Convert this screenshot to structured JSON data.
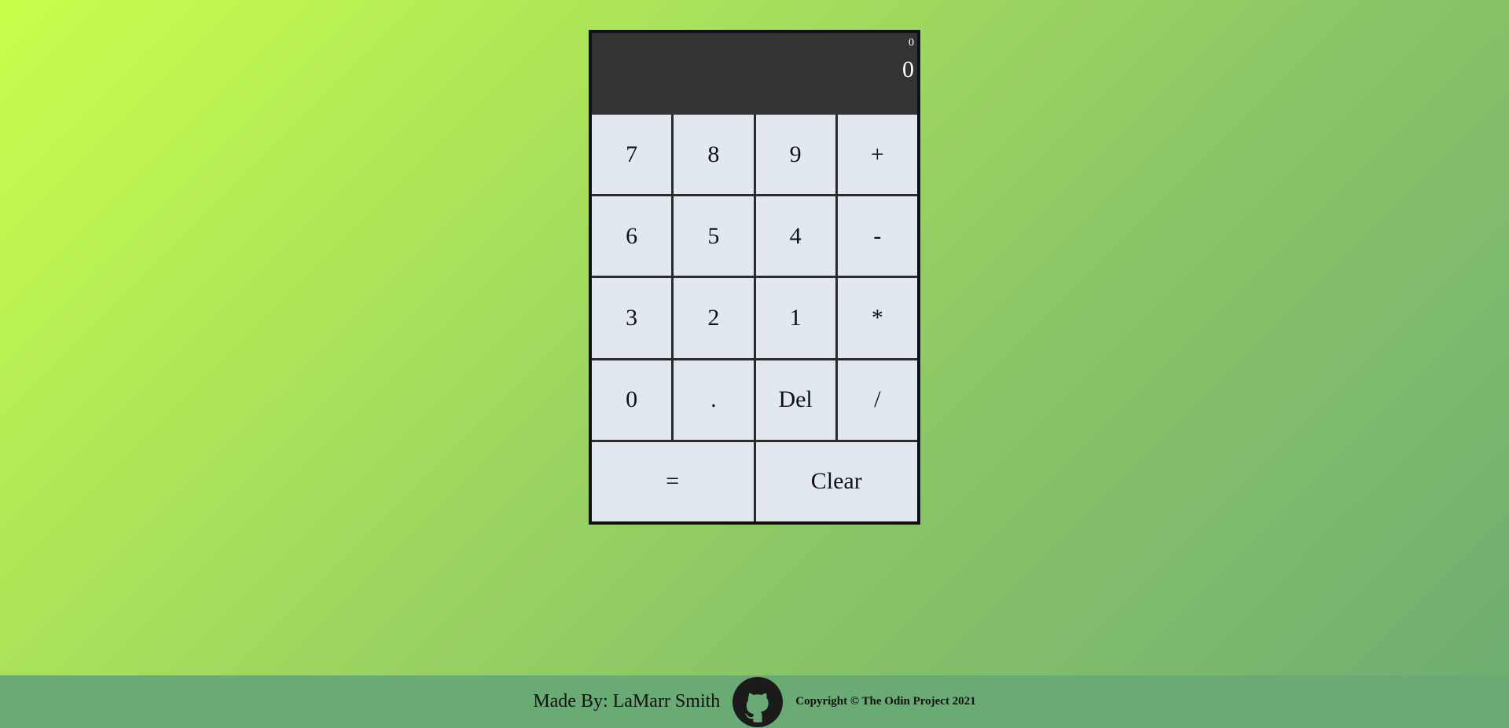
{
  "display": {
    "previous": "0",
    "current": "0"
  },
  "keys": [
    {
      "label": "7",
      "name": "key-7"
    },
    {
      "label": "8",
      "name": "key-8"
    },
    {
      "label": "9",
      "name": "key-9"
    },
    {
      "label": "+",
      "name": "key-add"
    },
    {
      "label": "6",
      "name": "key-6"
    },
    {
      "label": "5",
      "name": "key-5"
    },
    {
      "label": "4",
      "name": "key-4"
    },
    {
      "label": "-",
      "name": "key-subtract"
    },
    {
      "label": "3",
      "name": "key-3"
    },
    {
      "label": "2",
      "name": "key-2"
    },
    {
      "label": "1",
      "name": "key-1"
    },
    {
      "label": "*",
      "name": "key-multiply"
    },
    {
      "label": "0",
      "name": "key-0"
    },
    {
      "label": ".",
      "name": "key-decimal"
    },
    {
      "label": "Del",
      "name": "key-delete"
    },
    {
      "label": "/",
      "name": "key-divide"
    },
    {
      "label": "=",
      "name": "key-equals"
    },
    {
      "label": "Clear",
      "name": "key-clear"
    }
  ],
  "footer": {
    "author": "Made By: LaMarr Smith",
    "github_icon": "github-icon",
    "copyright": "Copyright © The Odin Project 2021"
  },
  "colors": {
    "display_bg": "#333333",
    "key_bg": "#e1e8f0",
    "footer_bg": "#6aaa74"
  }
}
